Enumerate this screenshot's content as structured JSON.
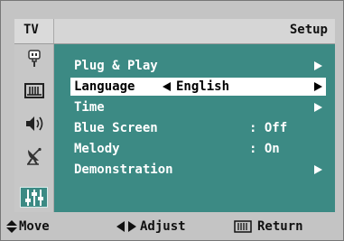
{
  "header": {
    "source": "TV",
    "title": "Setup"
  },
  "sidebar": {
    "icons": [
      "input-plug-icon",
      "picture-icon",
      "sound-speaker-icon",
      "channel-antenna-icon",
      "setup-sliders-icon"
    ],
    "active_index": 4
  },
  "menu": {
    "items": [
      {
        "label": "Plug & Play",
        "value": "",
        "has_arrow": true
      },
      {
        "label": "Language",
        "value": "English",
        "has_arrow": true,
        "selected": true
      },
      {
        "label": "Time",
        "value": "",
        "has_arrow": true
      },
      {
        "label": "Blue Screen",
        "value": ": Off",
        "has_arrow": false
      },
      {
        "label": "Melody",
        "value": ": On",
        "has_arrow": false
      },
      {
        "label": "Demonstration",
        "value": "",
        "has_arrow": true
      }
    ]
  },
  "footer": {
    "move": "Move",
    "adjust": "Adjust",
    "return": "Return"
  },
  "colors": {
    "panel": "#3c8a84",
    "selection": "#ffffff"
  }
}
